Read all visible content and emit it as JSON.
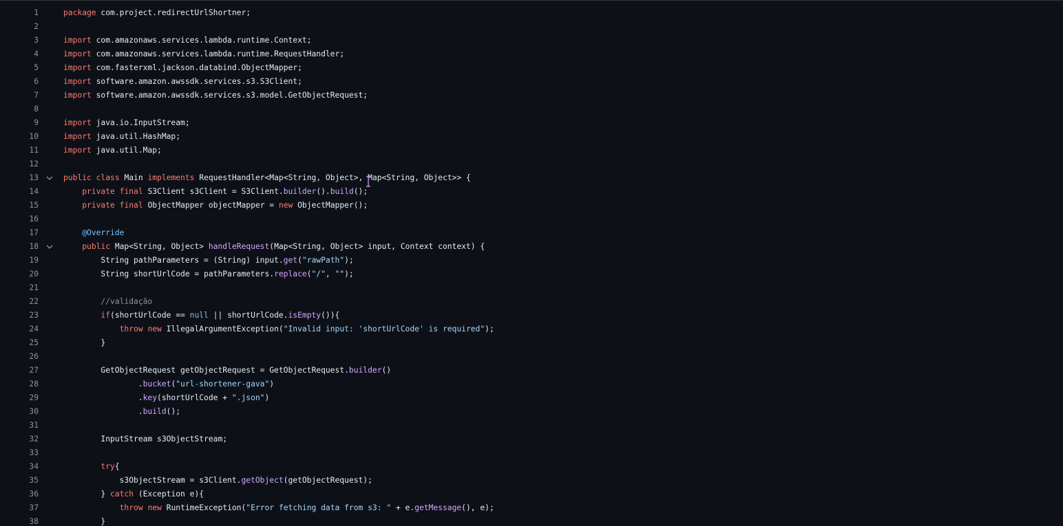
{
  "editor": {
    "lines": [
      {
        "n": "1",
        "fold": false,
        "tokens": [
          [
            "kw",
            "package"
          ],
          [
            "pl",
            " com.project.redirectUrlShortner;"
          ]
        ]
      },
      {
        "n": "2",
        "fold": false,
        "tokens": []
      },
      {
        "n": "3",
        "fold": false,
        "tokens": [
          [
            "kw",
            "import"
          ],
          [
            "pl",
            " com.amazonaws.services.lambda.runtime.Context;"
          ]
        ]
      },
      {
        "n": "4",
        "fold": false,
        "tokens": [
          [
            "kw",
            "import"
          ],
          [
            "pl",
            " com.amazonaws.services.lambda.runtime.RequestHandler;"
          ]
        ]
      },
      {
        "n": "5",
        "fold": false,
        "tokens": [
          [
            "kw",
            "import"
          ],
          [
            "pl",
            " com.fasterxml.jackson.databind.ObjectMapper;"
          ]
        ]
      },
      {
        "n": "6",
        "fold": false,
        "tokens": [
          [
            "kw",
            "import"
          ],
          [
            "pl",
            " software.amazon.awssdk.services.s3.S3Client;"
          ]
        ]
      },
      {
        "n": "7",
        "fold": false,
        "tokens": [
          [
            "kw",
            "import"
          ],
          [
            "pl",
            " software.amazon.awssdk.services.s3.model.GetObjectRequest;"
          ]
        ]
      },
      {
        "n": "8",
        "fold": false,
        "tokens": []
      },
      {
        "n": "9",
        "fold": false,
        "tokens": [
          [
            "kw",
            "import"
          ],
          [
            "pl",
            " java.io.InputStream;"
          ]
        ]
      },
      {
        "n": "10",
        "fold": false,
        "tokens": [
          [
            "kw",
            "import"
          ],
          [
            "pl",
            " java.util.HashMap;"
          ]
        ]
      },
      {
        "n": "11",
        "fold": false,
        "tokens": [
          [
            "kw",
            "import"
          ],
          [
            "pl",
            " java.util.Map;"
          ]
        ]
      },
      {
        "n": "12",
        "fold": false,
        "tokens": []
      },
      {
        "n": "13",
        "fold": true,
        "tokens": [
          [
            "kw",
            "public"
          ],
          [
            "pl",
            " "
          ],
          [
            "kw",
            "class"
          ],
          [
            "pl",
            " Main "
          ],
          [
            "kw",
            "implements"
          ],
          [
            "pl",
            " RequestHandler<Map<String, Object>, Map<String, Object>> {"
          ]
        ]
      },
      {
        "n": "14",
        "fold": false,
        "tokens": [
          [
            "pl",
            "    "
          ],
          [
            "kw",
            "private"
          ],
          [
            "pl",
            " "
          ],
          [
            "kw",
            "final"
          ],
          [
            "pl",
            " S3Client s3Client = S3Client."
          ],
          [
            "fn",
            "builder"
          ],
          [
            "pl",
            "()."
          ],
          [
            "fn",
            "build"
          ],
          [
            "pl",
            "();"
          ]
        ]
      },
      {
        "n": "15",
        "fold": false,
        "tokens": [
          [
            "pl",
            "    "
          ],
          [
            "kw",
            "private"
          ],
          [
            "pl",
            " "
          ],
          [
            "kw",
            "final"
          ],
          [
            "pl",
            " ObjectMapper objectMapper = "
          ],
          [
            "kw",
            "new"
          ],
          [
            "pl",
            " ObjectMapper();"
          ]
        ]
      },
      {
        "n": "16",
        "fold": false,
        "tokens": []
      },
      {
        "n": "17",
        "fold": false,
        "tokens": [
          [
            "pl",
            "    "
          ],
          [
            "ann",
            "@Override"
          ]
        ]
      },
      {
        "n": "18",
        "fold": true,
        "tokens": [
          [
            "pl",
            "    "
          ],
          [
            "kw",
            "public"
          ],
          [
            "pl",
            " Map<String, Object> "
          ],
          [
            "fn",
            "handleRequest"
          ],
          [
            "pl",
            "(Map<String, Object> input, Context context) {"
          ]
        ]
      },
      {
        "n": "19",
        "fold": false,
        "tokens": [
          [
            "pl",
            "        String pathParameters = (String) input."
          ],
          [
            "fn",
            "get"
          ],
          [
            "pl",
            "("
          ],
          [
            "str",
            "\"rawPath\""
          ],
          [
            "pl",
            ");"
          ]
        ]
      },
      {
        "n": "20",
        "fold": false,
        "tokens": [
          [
            "pl",
            "        String shortUrlCode = pathParameters."
          ],
          [
            "fn",
            "replace"
          ],
          [
            "pl",
            "("
          ],
          [
            "str",
            "\"/\""
          ],
          [
            "pl",
            ", "
          ],
          [
            "str",
            "\"\""
          ],
          [
            "pl",
            ");"
          ]
        ]
      },
      {
        "n": "21",
        "fold": false,
        "tokens": []
      },
      {
        "n": "22",
        "fold": false,
        "tokens": [
          [
            "pl",
            "        "
          ],
          [
            "cm",
            "//validação"
          ]
        ]
      },
      {
        "n": "23",
        "fold": false,
        "tokens": [
          [
            "pl",
            "        "
          ],
          [
            "kw",
            "if"
          ],
          [
            "pl",
            "(shortUrlCode == "
          ],
          [
            "lit",
            "null"
          ],
          [
            "pl",
            " || shortUrlCode."
          ],
          [
            "fn",
            "isEmpty"
          ],
          [
            "pl",
            "()){"
          ]
        ]
      },
      {
        "n": "24",
        "fold": false,
        "tokens": [
          [
            "pl",
            "            "
          ],
          [
            "kw",
            "throw"
          ],
          [
            "pl",
            " "
          ],
          [
            "kw",
            "new"
          ],
          [
            "pl",
            " IllegalArgumentException("
          ],
          [
            "str",
            "\"Invalid input: 'shortUrlCode' is required\""
          ],
          [
            "pl",
            ");"
          ]
        ]
      },
      {
        "n": "25",
        "fold": false,
        "tokens": [
          [
            "pl",
            "        }"
          ]
        ]
      },
      {
        "n": "26",
        "fold": false,
        "tokens": []
      },
      {
        "n": "27",
        "fold": false,
        "tokens": [
          [
            "pl",
            "        GetObjectRequest getObjectRequest = GetObjectRequest."
          ],
          [
            "fn",
            "builder"
          ],
          [
            "pl",
            "()"
          ]
        ]
      },
      {
        "n": "28",
        "fold": false,
        "tokens": [
          [
            "pl",
            "                ."
          ],
          [
            "fn",
            "bucket"
          ],
          [
            "pl",
            "("
          ],
          [
            "str",
            "\"url-shortener-gava\""
          ],
          [
            "pl",
            ")"
          ]
        ]
      },
      {
        "n": "29",
        "fold": false,
        "tokens": [
          [
            "pl",
            "                ."
          ],
          [
            "fn",
            "key"
          ],
          [
            "pl",
            "(shortUrlCode + "
          ],
          [
            "str",
            "\".json\""
          ],
          [
            "pl",
            ")"
          ]
        ]
      },
      {
        "n": "30",
        "fold": false,
        "tokens": [
          [
            "pl",
            "                ."
          ],
          [
            "fn",
            "build"
          ],
          [
            "pl",
            "();"
          ]
        ]
      },
      {
        "n": "31",
        "fold": false,
        "tokens": []
      },
      {
        "n": "32",
        "fold": false,
        "tokens": [
          [
            "pl",
            "        InputStream s3ObjectStream;"
          ]
        ]
      },
      {
        "n": "33",
        "fold": false,
        "tokens": []
      },
      {
        "n": "34",
        "fold": false,
        "tokens": [
          [
            "pl",
            "        "
          ],
          [
            "kw",
            "try"
          ],
          [
            "pl",
            "{"
          ]
        ]
      },
      {
        "n": "35",
        "fold": false,
        "tokens": [
          [
            "pl",
            "            s3ObjectStream = s3Client."
          ],
          [
            "fn",
            "getObject"
          ],
          [
            "pl",
            "(getObjectRequest);"
          ]
        ]
      },
      {
        "n": "36",
        "fold": false,
        "tokens": [
          [
            "pl",
            "        } "
          ],
          [
            "kw",
            "catch"
          ],
          [
            "pl",
            " (Exception e){"
          ]
        ]
      },
      {
        "n": "37",
        "fold": false,
        "tokens": [
          [
            "pl",
            "            "
          ],
          [
            "kw",
            "throw"
          ],
          [
            "pl",
            " "
          ],
          [
            "kw",
            "new"
          ],
          [
            "pl",
            " RuntimeException("
          ],
          [
            "str",
            "\"Error fetching data from s3: \""
          ],
          [
            "pl",
            " + e."
          ],
          [
            "fn",
            "getMessage"
          ],
          [
            "pl",
            "(), e);"
          ]
        ]
      },
      {
        "n": "38",
        "fold": false,
        "tokens": [
          [
            "pl",
            "        }"
          ]
        ]
      }
    ]
  },
  "colors": {
    "background": "#0d1117",
    "line_number": "#8b949e",
    "keyword": "#ff7b72",
    "function": "#d2a8ff",
    "string": "#a5d6ff",
    "annotation": "#79c0ff",
    "comment": "#8b949e",
    "text": "#e6edf3"
  }
}
